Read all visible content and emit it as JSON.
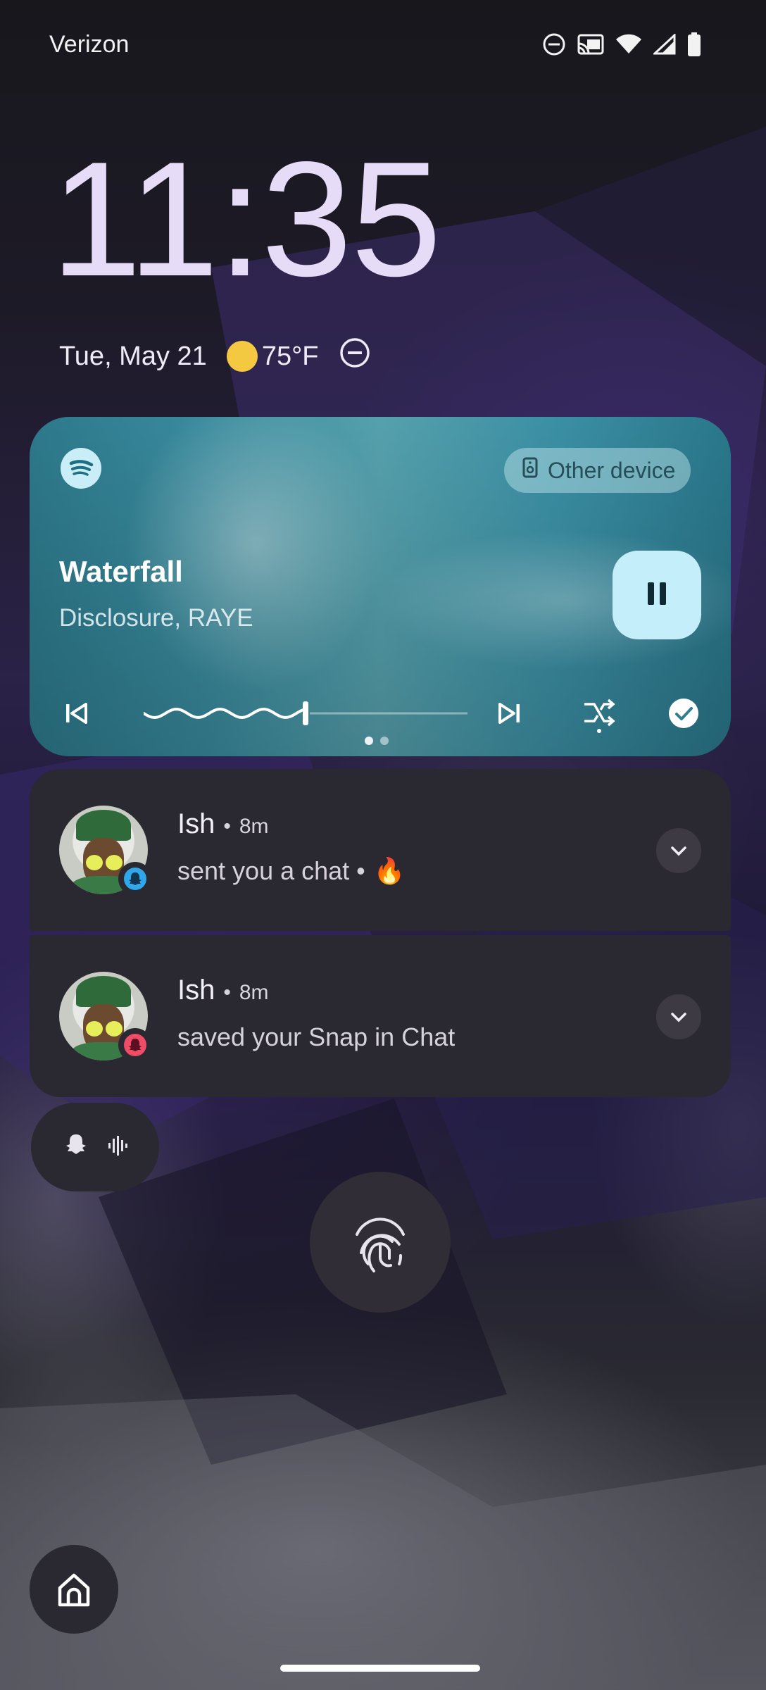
{
  "status_bar": {
    "carrier": "Verizon",
    "icons": [
      "do-not-disturb-icon",
      "cast-icon",
      "wifi-icon",
      "cell-signal-icon",
      "battery-icon"
    ]
  },
  "lockscreen": {
    "time": "11:35",
    "date": "Tue, May 21",
    "weather": {
      "temp": "75°F",
      "condition_icon": "sun-icon"
    },
    "dnd_icon": "do-not-disturb-icon"
  },
  "media": {
    "app_icon": "spotify-icon",
    "output_device": "Other device",
    "title": "Waterfall",
    "artist": "Disclosure, RAYE",
    "state": "playing",
    "progress": 0.5,
    "page_count": 2,
    "active_page": 1,
    "controls": [
      "previous-icon",
      "pause-icon",
      "next-icon",
      "shuffle-icon",
      "check-icon"
    ]
  },
  "notifications": [
    {
      "sender": "Ish",
      "time": "8m",
      "message": "sent you a chat •",
      "emoji": "🔥",
      "badge_color": "#2fa7e8"
    },
    {
      "sender": "Ish",
      "time": "8m",
      "message": "saved your Snap in Chat",
      "emoji": "",
      "badge_color": "#ef4c66"
    }
  ],
  "colors": {
    "clock": "#e6dcf8",
    "card_bg": "#2a2830",
    "pause_button": "#c5eefb"
  }
}
